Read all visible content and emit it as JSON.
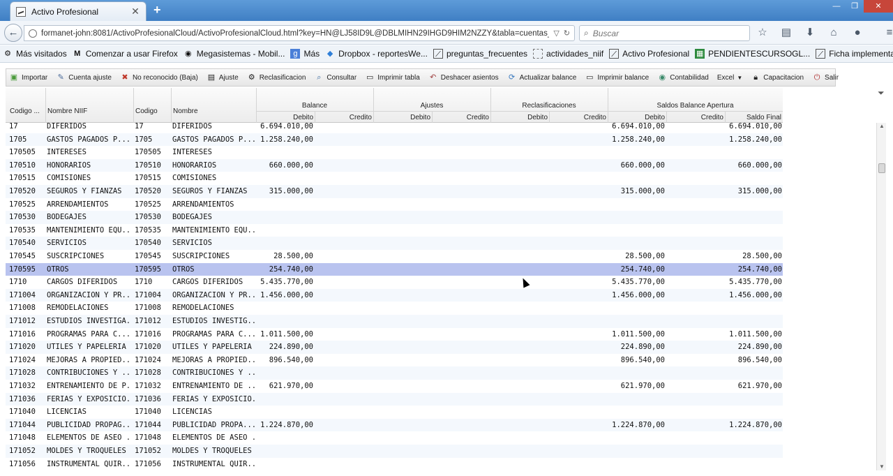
{
  "browser": {
    "tab_title": "Activo Profesional",
    "tab_close": "✕",
    "new_tab": "+",
    "url": "formanet-john:8081/ActivoProfesionalCloud/ActivoProfesionalCloud.html?key=HN@LJ58ID9L@DBLMIHN29IHGD9HIM2NZZY&tabla=cuentas_mai",
    "search_placeholder": "Buscar",
    "window_controls": [
      "—",
      "❐",
      "✕"
    ],
    "nav_icons": [
      "star-icon",
      "reader-icon",
      "download-icon",
      "home-icon",
      "chat-icon",
      "menu-icon"
    ],
    "bookmarks": [
      {
        "label": "Más visitados",
        "icon": "gear-icon"
      },
      {
        "label": "Comenzar a usar Firefox",
        "icon": "m-icon"
      },
      {
        "label": "Megasistemas - Mobil...",
        "icon": "globe-icon"
      },
      {
        "label": "Más",
        "icon": "google-icon"
      },
      {
        "label": "Dropbox - reportesWe...",
        "icon": "dropbox-icon"
      },
      {
        "label": "preguntas_frecuentes",
        "icon": "chart-icon"
      },
      {
        "label": "actividades_niif",
        "icon": "page-icon"
      },
      {
        "label": "Activo Profesional",
        "icon": "chart-icon"
      },
      {
        "label": "PENDIENTESCURSOGL...",
        "icon": "sheet-icon"
      },
      {
        "label": "Ficha implementacion",
        "icon": "chart-icon"
      }
    ]
  },
  "toolbar": {
    "buttons": [
      {
        "label": "Importar",
        "icon": "import-icon",
        "color": "#4a9a3a"
      },
      {
        "label": "Cuenta ajuste",
        "icon": "edit-icon",
        "color": "#4a6a9a"
      },
      {
        "label": "No reconocido (Baja)",
        "icon": "delete-icon",
        "color": "#c0392b"
      },
      {
        "label": "Ajuste",
        "icon": "doc-icon",
        "color": "#6a6a6a"
      },
      {
        "label": "Reclasificacion",
        "icon": "gear-icon",
        "color": "#6a6a6a"
      },
      {
        "label": "Consultar",
        "icon": "search-icon",
        "color": "#3a6aa0"
      },
      {
        "label": "Imprimir tabla",
        "icon": "print-icon",
        "color": "#555555"
      },
      {
        "label": "Deshacer asientos",
        "icon": "undo-icon",
        "color": "#a04040"
      },
      {
        "label": "Actualizar balance",
        "icon": "refresh-icon",
        "color": "#3a7ac0"
      },
      {
        "label": "Imprimir balance",
        "icon": "print-icon",
        "color": "#555555"
      },
      {
        "label": "Contabilidad",
        "icon": "globe-icon",
        "color": "#3a8a6a"
      },
      {
        "label": "Excel",
        "icon": "",
        "color": "#333333"
      },
      {
        "label": "Capacitacion",
        "icon": "lock-icon",
        "color": "#555555"
      },
      {
        "label": "Salir",
        "icon": "power-icon",
        "color": "#b03030"
      }
    ]
  },
  "grid": {
    "headers": {
      "codigo1": "Codigo ...",
      "nombre_niif": "Nombre NIIF",
      "codigo2": "Codigo",
      "nombre": "Nombre",
      "groups": [
        "Balance",
        "Ajustes",
        "Reclasificaciones",
        "Saldos Balance Apertura"
      ],
      "sub": [
        "Debito",
        "Credito",
        "Debito",
        "Credito",
        "Debito",
        "Credito",
        "Debito",
        "Credito",
        "Saldo Final"
      ]
    },
    "rows": [
      [
        "17",
        "DIFERIDOS",
        "17",
        "DIFERIDOS",
        "6.694.010,00",
        "6.694.010,00",
        "6.694.010,00"
      ],
      [
        "1705",
        "GASTOS PAGADOS P...",
        "1705",
        "GASTOS PAGADOS P...",
        "1.258.240,00",
        "1.258.240,00",
        "1.258.240,00"
      ],
      [
        "170505",
        "INTERESES",
        "170505",
        "INTERESES",
        "",
        "",
        ""
      ],
      [
        "170510",
        "HONORARIOS",
        "170510",
        "HONORARIOS",
        "660.000,00",
        "660.000,00",
        "660.000,00"
      ],
      [
        "170515",
        "COMISIONES",
        "170515",
        "COMISIONES",
        "",
        "",
        ""
      ],
      [
        "170520",
        "SEGUROS Y FIANZAS",
        "170520",
        "SEGUROS Y FIANZAS",
        "315.000,00",
        "315.000,00",
        "315.000,00"
      ],
      [
        "170525",
        "ARRENDAMIENTOS",
        "170525",
        "ARRENDAMIENTOS",
        "",
        "",
        ""
      ],
      [
        "170530",
        "BODEGAJES",
        "170530",
        "BODEGAJES",
        "",
        "",
        ""
      ],
      [
        "170535",
        "MANTENIMIENTO EQU...",
        "170535",
        "MANTENIMIENTO EQU...",
        "",
        "",
        ""
      ],
      [
        "170540",
        "SERVICIOS",
        "170540",
        "SERVICIOS",
        "",
        "",
        ""
      ],
      [
        "170545",
        "SUSCRIPCIONES",
        "170545",
        "SUSCRIPCIONES",
        "28.500,00",
        "28.500,00",
        "28.500,00"
      ],
      [
        "170595",
        "OTROS",
        "170595",
        "OTROS",
        "254.740,00",
        "254.740,00",
        "254.740,00"
      ],
      [
        "1710",
        "CARGOS DIFERIDOS",
        "1710",
        "CARGOS DIFERIDOS",
        "5.435.770,00",
        "5.435.770,00",
        "5.435.770,00"
      ],
      [
        "171004",
        "ORGANIZACION Y PR...",
        "171004",
        "ORGANIZACION Y PR...",
        "1.456.000,00",
        "1.456.000,00",
        "1.456.000,00"
      ],
      [
        "171008",
        "REMODELACIONES",
        "171008",
        "REMODELACIONES",
        "",
        "",
        ""
      ],
      [
        "171012",
        "ESTUDIOS INVESTIGA...",
        "171012",
        "ESTUDIOS INVESTIG...",
        "",
        "",
        ""
      ],
      [
        "171016",
        "PROGRAMAS PARA C...",
        "171016",
        "PROGRAMAS PARA C...",
        "1.011.500,00",
        "1.011.500,00",
        "1.011.500,00"
      ],
      [
        "171020",
        "UTILES Y PAPELERIA",
        "171020",
        "UTILES Y PAPELERIA",
        "224.890,00",
        "224.890,00",
        "224.890,00"
      ],
      [
        "171024",
        "MEJORAS A PROPIED...",
        "171024",
        "MEJORAS A PROPIED...",
        "896.540,00",
        "896.540,00",
        "896.540,00"
      ],
      [
        "171028",
        "CONTRIBUCIONES Y ...",
        "171028",
        "CONTRIBUCIONES Y ...",
        "",
        "",
        ""
      ],
      [
        "171032",
        "ENTRENAMIENTO DE P...",
        "171032",
        "ENTRENAMIENTO DE ...",
        "621.970,00",
        "621.970,00",
        "621.970,00"
      ],
      [
        "171036",
        "FERIAS Y EXPOSICIO...",
        "171036",
        "FERIAS Y EXPOSICIO...",
        "",
        "",
        ""
      ],
      [
        "171040",
        "LICENCIAS",
        "171040",
        "LICENCIAS",
        "",
        "",
        ""
      ],
      [
        "171044",
        "PUBLICIDAD PROPAG...",
        "171044",
        "PUBLICIDAD PROPA...",
        "1.224.870,00",
        "1.224.870,00",
        "1.224.870,00"
      ],
      [
        "171048",
        "ELEMENTOS DE ASEO ...",
        "171048",
        "ELEMENTOS DE ASEO ...",
        "",
        "",
        ""
      ],
      [
        "171052",
        "MOLDES Y TROQUELES",
        "171052",
        "MOLDES Y TROQUELES",
        "",
        "",
        ""
      ],
      [
        "171056",
        "INSTRUMENTAL QUIR...",
        "171056",
        "INSTRUMENTAL QUIR...",
        "",
        "",
        ""
      ]
    ],
    "selected_row": 11,
    "colors": {
      "selected": "#b9c3ef",
      "alt_row": "#f4f8fd"
    }
  }
}
